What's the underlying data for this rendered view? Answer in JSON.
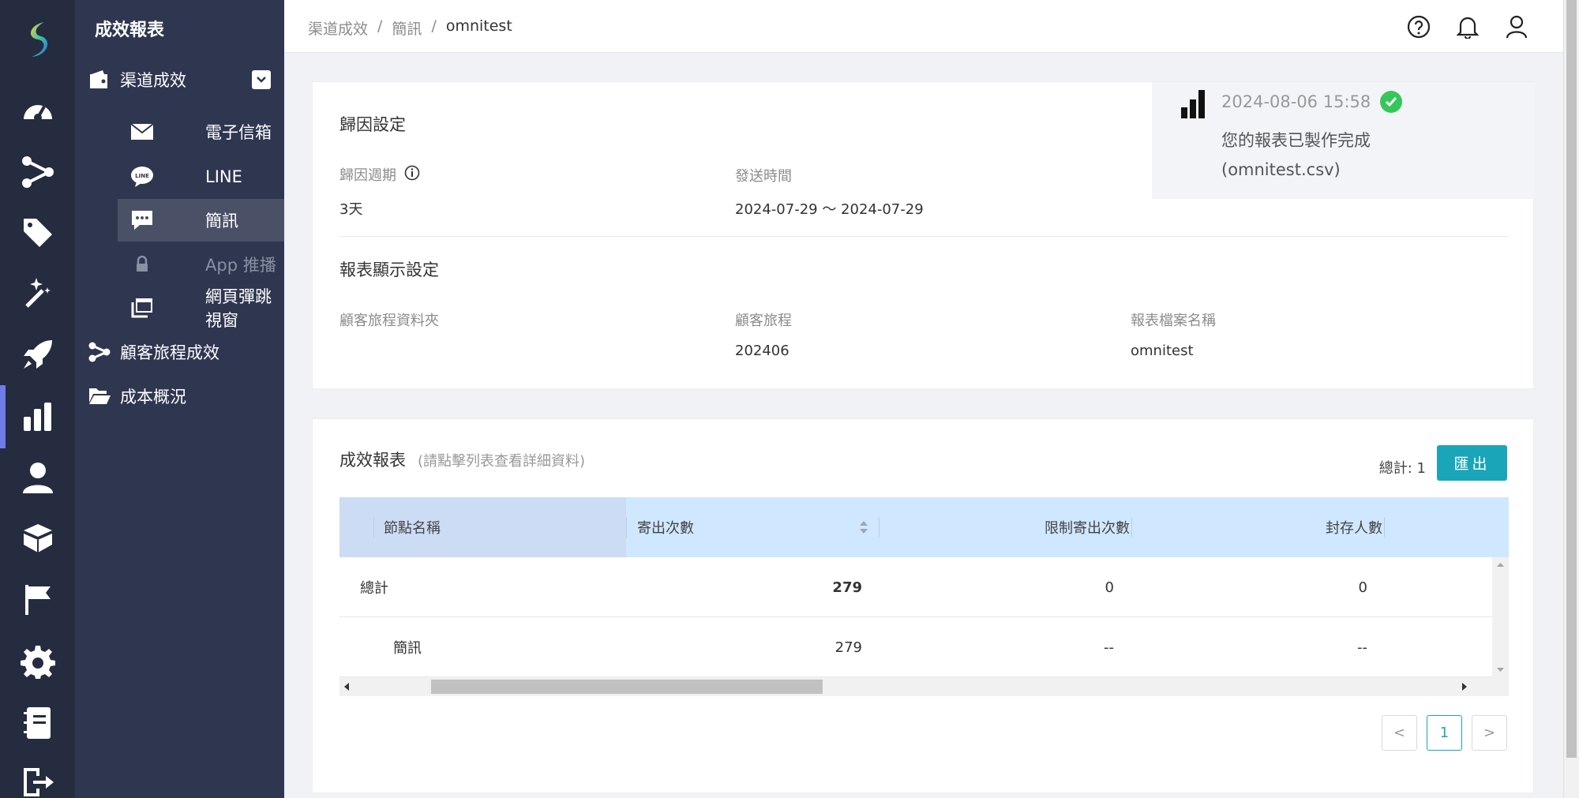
{
  "subnav": {
    "title": "成效報表",
    "groups": [
      {
        "label": "渠道成效"
      },
      {
        "label": "顧客旅程成效"
      },
      {
        "label": "成本概況"
      }
    ],
    "items": [
      {
        "label": "電子信箱"
      },
      {
        "label": "LINE"
      },
      {
        "label": "簡訊"
      },
      {
        "label": "App 推播"
      },
      {
        "label": "網頁彈跳視窗"
      }
    ]
  },
  "breadcrumb": [
    "渠道成效",
    "/",
    "簡訊",
    "/",
    "omnitest"
  ],
  "attribution": {
    "title": "歸因設定",
    "period_label": "歸因週期",
    "period_value": "3天",
    "send_time_label": "發送時間",
    "send_time_value": "2024-07-29 ～ 2024-07-29"
  },
  "display": {
    "title": "報表顯示設定",
    "folder_label": "顧客旅程資料夾",
    "folder_value": "",
    "journey_label": "顧客旅程",
    "journey_value": "202406",
    "filename_label": "報表檔案名稱",
    "filename_value": "omnitest"
  },
  "notice": {
    "datetime": "2024-08-06 15:58",
    "line1": "您的報表已製作完成",
    "line2": "(omnitest.csv)"
  },
  "report": {
    "title": "成效報表",
    "hint": "(請點擊列表查看詳細資料)",
    "total": "總計: 1",
    "export_label": "匯出",
    "columns": [
      "節點名稱",
      "寄出次數",
      "限制寄出次數",
      "封存人數"
    ],
    "rows": [
      {
        "name": "總計",
        "sent": "279",
        "limited": "0",
        "archived": "0"
      },
      {
        "name": "簡訊",
        "sent": "279",
        "limited": "--",
        "archived": "--"
      }
    ]
  },
  "pagination": {
    "prev": "<",
    "current": "1",
    "next": ">"
  },
  "colors": {
    "accent": "#1aa5b8",
    "rail": "#252c3f",
    "subnav": "#2f3650",
    "success": "#36c75a",
    "rail_active": "#6f7ce8"
  },
  "icons": {
    "rail": [
      "logo-icon",
      "dashboard-icon",
      "journey-icon",
      "tag-icon",
      "magic-wand-icon",
      "rocket-icon",
      "bar-chart-icon",
      "user-icon",
      "boxes-icon",
      "flag-icon",
      "gear-icon",
      "notebook-icon",
      "logout-icon"
    ],
    "topbar": [
      "help-icon",
      "bell-icon",
      "profile-icon"
    ]
  }
}
